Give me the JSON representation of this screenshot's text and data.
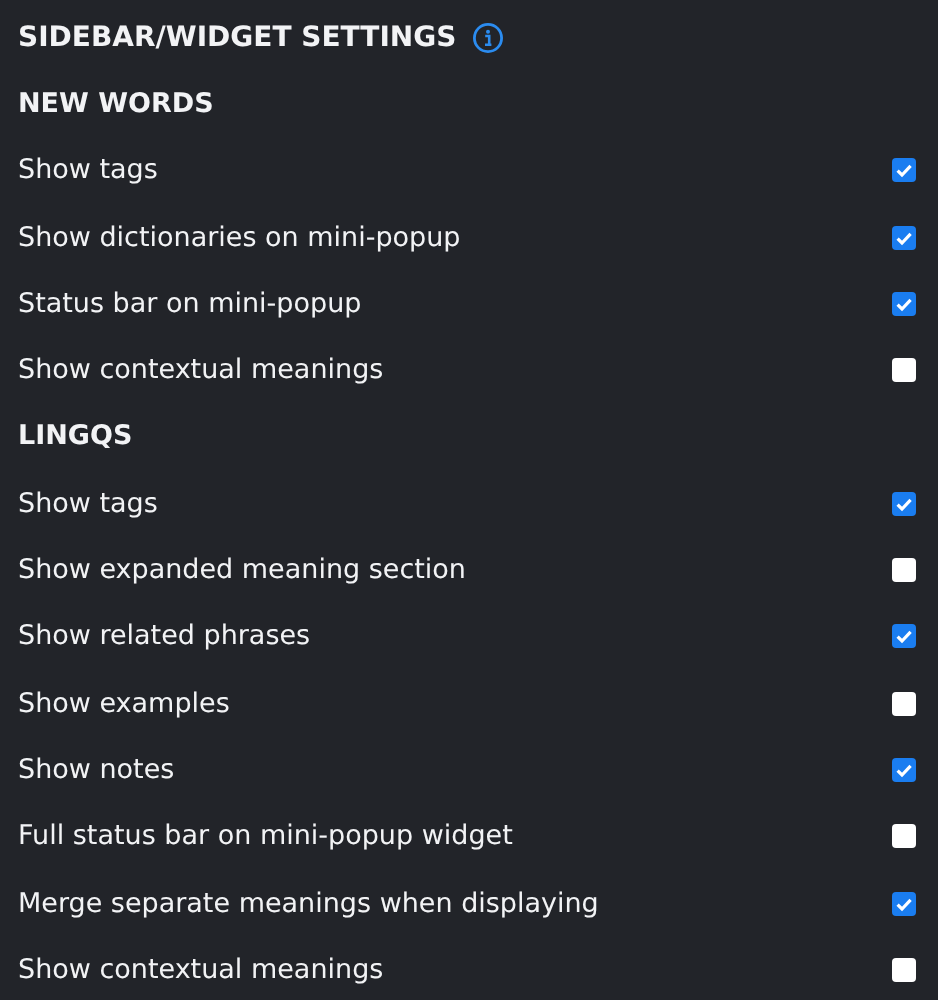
{
  "title": "SIDEBAR/WIDGET SETTINGS",
  "sections": [
    {
      "heading": "NEW WORDS",
      "options": [
        {
          "label": "Show tags",
          "checked": true
        },
        {
          "label": "Show dictionaries on mini-popup",
          "checked": true
        },
        {
          "label": "Status bar on mini-popup",
          "checked": true
        },
        {
          "label": "Show contextual meanings",
          "checked": false
        }
      ]
    },
    {
      "heading": "LINGQS",
      "options": [
        {
          "label": "Show tags",
          "checked": true
        },
        {
          "label": "Show expanded meaning section",
          "checked": false
        },
        {
          "label": "Show related phrases",
          "checked": true
        },
        {
          "label": "Show examples",
          "checked": false
        },
        {
          "label": "Show notes",
          "checked": true
        },
        {
          "label": "Full status bar on mini-popup widget",
          "checked": false
        },
        {
          "label": "Merge separate meanings when displaying",
          "checked": true
        },
        {
          "label": "Show contextual meanings",
          "checked": false
        }
      ]
    }
  ]
}
